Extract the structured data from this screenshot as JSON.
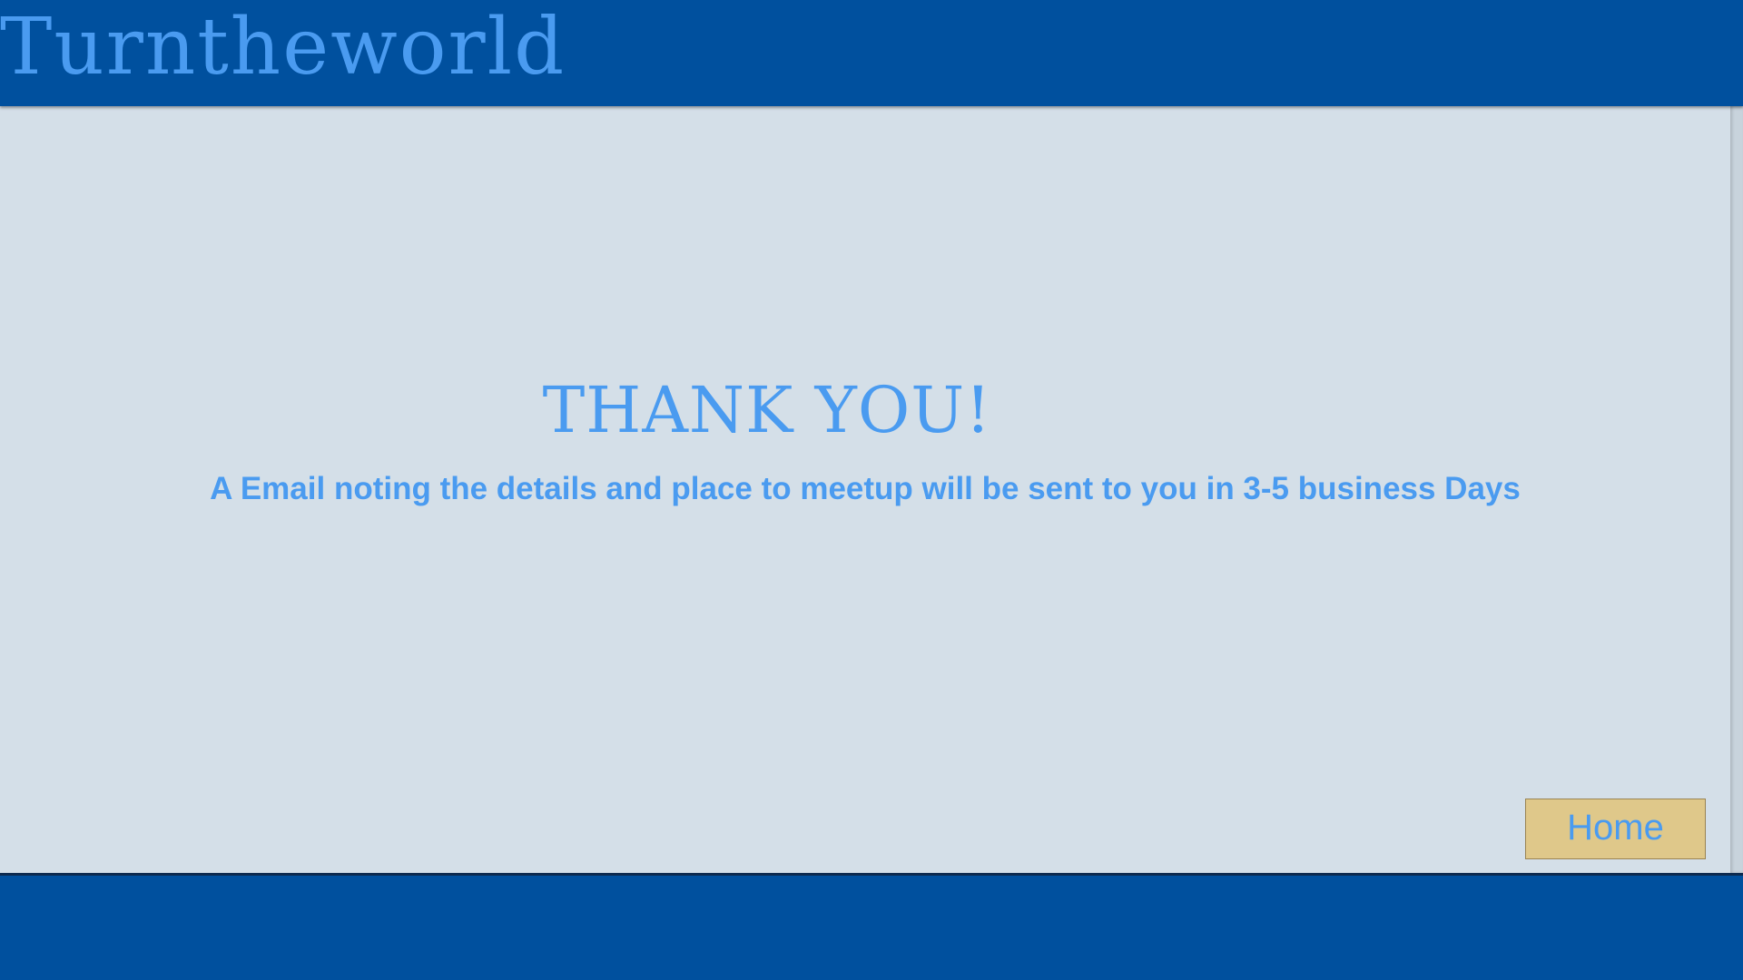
{
  "header": {
    "brand": "Turntheworld"
  },
  "main": {
    "title": "THANK YOU!",
    "message": "A Email noting the details and place to meetup will be sent to you in 3-5 business Days",
    "home_button": "Home"
  },
  "colors": {
    "header_bg": "#00509e",
    "content_bg": "#d4dfe8",
    "text_accent": "#4a9bf0",
    "button_bg": "#dfc88a"
  }
}
